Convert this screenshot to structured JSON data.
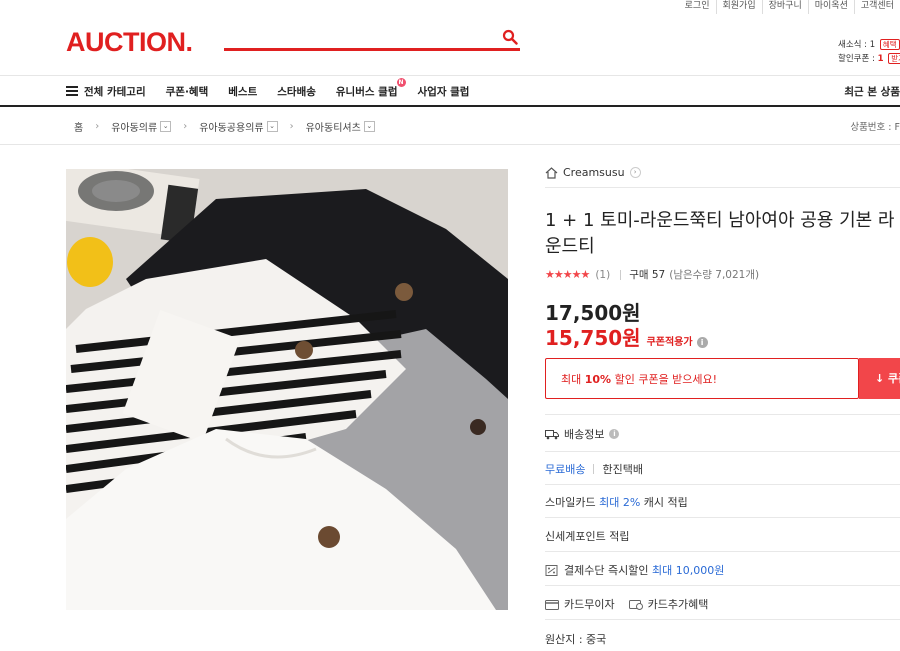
{
  "util_links": [
    "로그인",
    "회원가입",
    "장바구니",
    "마이옥션",
    "고객센터"
  ],
  "logo": "AUCTION.",
  "search": {
    "placeholder": ""
  },
  "coupon_box": {
    "new_coupon_label": "새소식 :",
    "new_coupon_count": "1",
    "new_coupon_tag": "혜택",
    "discount_label": "할인쿠폰 :",
    "discount_count": "1",
    "discount_tag": "받기"
  },
  "nav": {
    "all_categories": "전체 카테고리",
    "items": [
      "쿠폰·혜택",
      "베스트",
      "스타배송",
      "유니버스 클럽",
      "사업자 클럽"
    ],
    "badge": "N",
    "recent": "최근 본 상품"
  },
  "breadcrumb": {
    "home": "홈",
    "levels": [
      "유아동의류",
      "유아동공용의류",
      "유아동티셔츠"
    ],
    "product_no_label": "상품번호 : F"
  },
  "product": {
    "seller": "Creamsusu",
    "title": "1 + 1 토미-라운드쭉티 남아여아 공용 기본 라운드티",
    "stars": "★★★★★",
    "rating": 5,
    "review_count": "(1)",
    "purchase_label": "구매 57",
    "remaining": "(남은수량 7,021개)",
    "price_original": "17,500원",
    "price_sale": "15,750원",
    "sale_label": "쿠폰적용가",
    "coupon_text_pre": "최대 ",
    "coupon_text_pct": "10%",
    "coupon_text_post": " 할인 쿠폰을 받으세요!",
    "coupon_button": "↓ 쿠폰"
  },
  "shipping": {
    "title": "배송정보",
    "free": "무료배송",
    "courier": "한진택배"
  },
  "benefits": {
    "smile_pre": "스마일카드",
    "smile_hl": "최대 2%",
    "smile_post": "캐시 적립",
    "shinsegae": "신세계포인트 적립",
    "payment_pre": "결제수단 즉시할인",
    "payment_hl": "최대 10,000원",
    "card_nointerest": "카드무이자",
    "card_extra": "카드추가혜택"
  },
  "origin": "원산지 : 중국",
  "colors": {
    "brand": "#e02020",
    "accent_blue": "#2b6bd6",
    "star": "#f2464a"
  }
}
